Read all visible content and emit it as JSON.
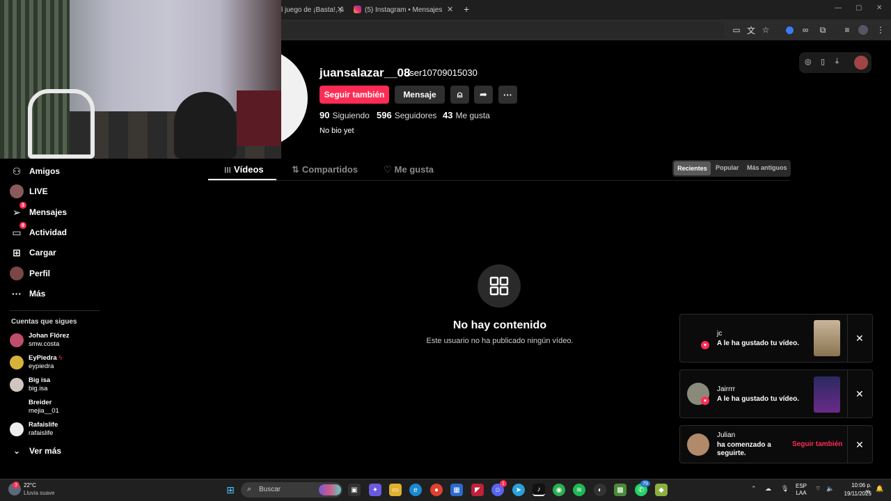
{
  "browser": {
    "tabs": [
      {
        "title": "l juego de ¡Basta!, ¡la"
      },
      {
        "title": "(5) Instagram • Mensajes"
      }
    ],
    "new_tab": "+",
    "window_controls": [
      "—",
      "▢",
      "✕"
    ]
  },
  "profile": {
    "username": "juansalazar__08",
    "nickname": "user10709015030",
    "follow_label": "Seguir también",
    "message_label": "Mensaje",
    "following_count": "90",
    "following_label": "Siguiendo",
    "followers_count": "596",
    "followers_label": "Seguidores",
    "likes_count": "43",
    "likes_label": "Me gusta",
    "bio": "No bio yet"
  },
  "tabs": {
    "videos": "Vídeos",
    "reposts": "Compartidos",
    "liked": "Me gusta"
  },
  "sort": {
    "recent": "Recientes",
    "popular": "Popular",
    "oldest": "Más antiguos"
  },
  "empty_state": {
    "title": "No hay contenido",
    "subtitle": "Este usuario no ha publicado ningún vídeo."
  },
  "nav": {
    "items": [
      {
        "label": "Amigos",
        "icon": "friends-icon"
      },
      {
        "label": "LIVE",
        "icon": "live-icon"
      },
      {
        "label": "Mensajes",
        "icon": "messages-icon",
        "badge": "3"
      },
      {
        "label": "Actividad",
        "icon": "activity-icon",
        "badge": "9"
      },
      {
        "label": "Cargar",
        "icon": "upload-icon"
      },
      {
        "label": "Perfil",
        "icon": "profile-icon"
      },
      {
        "label": "Más",
        "icon": "more-icon"
      }
    ],
    "following_heading": "Cuentas que sigues",
    "following": [
      {
        "name": "Johan Flórez",
        "handle": "smw.costa"
      },
      {
        "name": "EyPiedra",
        "handle": "eypiedra"
      },
      {
        "name": "Big isa",
        "handle": "big.isa"
      },
      {
        "name": "Breider",
        "handle": "mejia__01"
      },
      {
        "name": "Rafaislife",
        "handle": "rafaislife"
      }
    ],
    "see_more": "Ver más"
  },
  "notifications": [
    {
      "name": "jc",
      "text": "A le ha gustado tu vídeo."
    },
    {
      "name": "Jairrrr",
      "text": "A le ha gustado tu vídeo."
    },
    {
      "name": "Julian",
      "text_line1": "ha comenzado a",
      "text_line2": "seguirte.",
      "action": "Seguir también"
    }
  ],
  "taskbar": {
    "weather_temp": "22°C",
    "weather_desc": "Lluvia suave",
    "search_placeholder": "Buscar",
    "lang_line1": "ESP",
    "lang_line2": "LAA",
    "time": "10:06 p. m.",
    "date": "19/11/2025",
    "badge_discord": "1",
    "badge_whatsapp": "79",
    "badge_weather": "3"
  },
  "colors": {
    "accent": "#fe2c55",
    "background": "#000000"
  }
}
